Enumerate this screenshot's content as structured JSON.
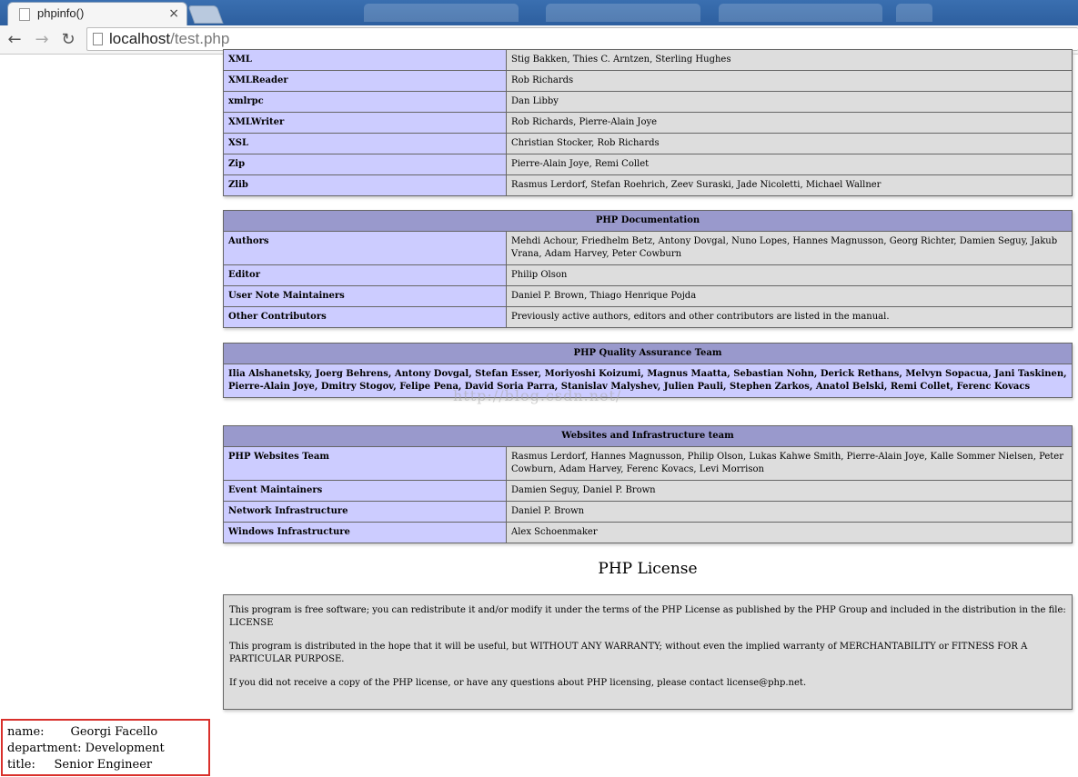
{
  "browser": {
    "tab_title": "phpinfo()",
    "tab_close": "×",
    "back": "←",
    "forward": "→",
    "reload": "↻",
    "url_host": "localhost",
    "url_path": "/test.php"
  },
  "credits_top": {
    "rows": [
      {
        "name": "XML",
        "value": "Stig Bakken, Thies C. Arntzen, Sterling Hughes"
      },
      {
        "name": "XMLReader",
        "value": "Rob Richards"
      },
      {
        "name": "xmlrpc",
        "value": "Dan Libby"
      },
      {
        "name": "XMLWriter",
        "value": "Rob Richards, Pierre-Alain Joye"
      },
      {
        "name": "XSL",
        "value": "Christian Stocker, Rob Richards"
      },
      {
        "name": "Zip",
        "value": "Pierre-Alain Joye, Remi Collet"
      },
      {
        "name": "Zlib",
        "value": "Rasmus Lerdorf, Stefan Roehrich, Zeev Suraski, Jade Nicoletti, Michael Wallner"
      }
    ]
  },
  "documentation": {
    "heading": "PHP Documentation",
    "rows": [
      {
        "name": "Authors",
        "value": "Mehdi Achour, Friedhelm Betz, Antony Dovgal, Nuno Lopes, Hannes Magnusson, Georg Richter, Damien Seguy, Jakub Vrana, Adam Harvey, Peter Cowburn"
      },
      {
        "name": "Editor",
        "value": "Philip Olson"
      },
      {
        "name": "User Note Maintainers",
        "value": "Daniel P. Brown, Thiago Henrique Pojda"
      },
      {
        "name": "Other Contributors",
        "value": "Previously active authors, editors and other contributors are listed in the manual."
      }
    ]
  },
  "qa": {
    "heading": "PHP Quality Assurance Team",
    "members": "Ilia Alshanetsky, Joerg Behrens, Antony Dovgal, Stefan Esser, Moriyoshi Koizumi, Magnus Maatta, Sebastian Nohn, Derick Rethans, Melvyn Sopacua, Jani Taskinen, Pierre-Alain Joye, Dmitry Stogov, Felipe Pena, David Soria Parra, Stanislav Malyshev, Julien Pauli, Stephen Zarkos, Anatol Belski, Remi Collet, Ferenc Kovacs"
  },
  "websites": {
    "heading": "Websites and Infrastructure team",
    "rows": [
      {
        "name": "PHP Websites Team",
        "value": "Rasmus Lerdorf, Hannes Magnusson, Philip Olson, Lukas Kahwe Smith, Pierre-Alain Joye, Kalle Sommer Nielsen, Peter Cowburn, Adam Harvey, Ferenc Kovacs, Levi Morrison"
      },
      {
        "name": "Event Maintainers",
        "value": "Damien Seguy, Daniel P. Brown"
      },
      {
        "name": "Network Infrastructure",
        "value": "Daniel P. Brown"
      },
      {
        "name": "Windows Infrastructure",
        "value": "Alex Schoenmaker"
      }
    ]
  },
  "license": {
    "title": "PHP License",
    "paragraphs": [
      "This program is free software; you can redistribute it and/or modify it under the terms of the PHP License as published by the PHP Group and included in the distribution in the file: LICENSE",
      "This program is distributed in the hope that it will be useful, but WITHOUT ANY WARRANTY; without even the implied warranty of MERCHANTABILITY or FITNESS FOR A PARTICULAR PURPOSE.",
      "If you did not receive a copy of the PHP license, or have any questions about PHP licensing, please contact license@php.net."
    ]
  },
  "watermark": "http://blog.csdn.net/",
  "employee": {
    "name_line": "name:       Georgi Facello",
    "department_line": "department: Development",
    "title_line": "title:     Senior Engineer"
  }
}
